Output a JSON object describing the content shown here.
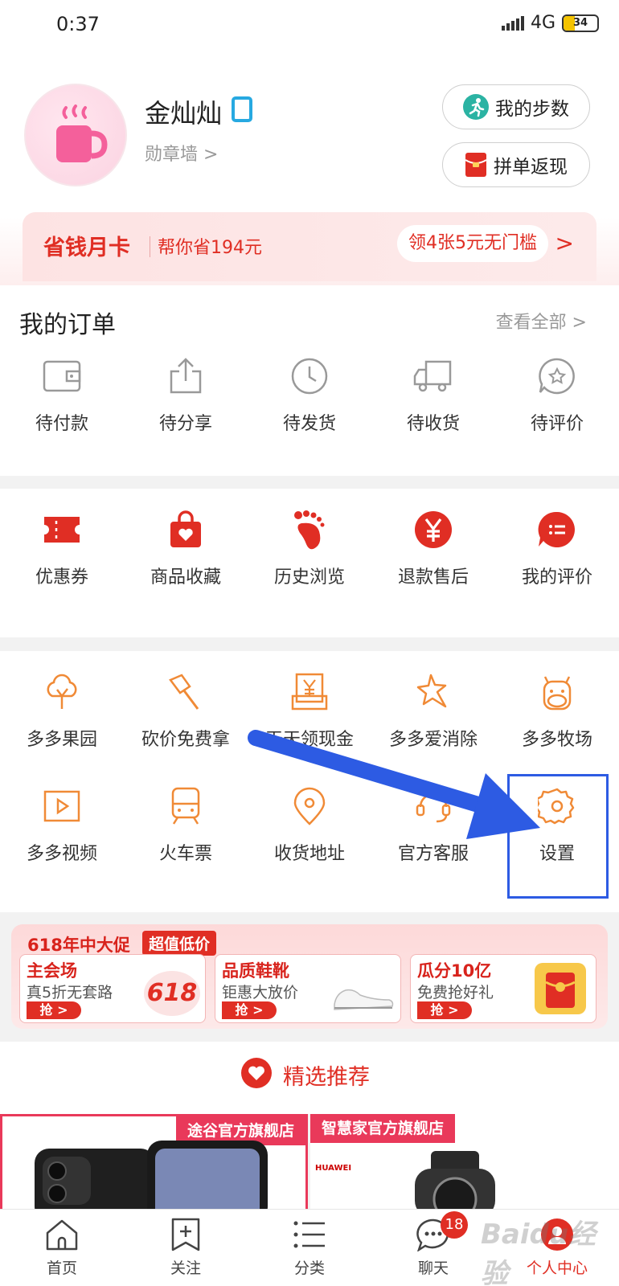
{
  "status_bar": {
    "time": "0:37",
    "network": "4G",
    "battery": "34",
    "battery_level": 0.34
  },
  "profile": {
    "name": "金灿灿",
    "medal_link": "勋章墙 >"
  },
  "header_buttons": {
    "steps": "我的步数",
    "regroup": "拼单返现"
  },
  "savings_card": {
    "title": "省钱月卡",
    "subtitle": "帮你省194元",
    "coupon": "领4张5元无门槛",
    "arrow": ">"
  },
  "orders": {
    "title": "我的订单",
    "view_all": "查看全部 >",
    "items": [
      {
        "label": "待付款",
        "icon": "wallet-icon"
      },
      {
        "label": "待分享",
        "icon": "share-icon"
      },
      {
        "label": "待发货",
        "icon": "clock-icon"
      },
      {
        "label": "待收货",
        "icon": "truck-icon"
      },
      {
        "label": "待评价",
        "icon": "review-icon"
      }
    ]
  },
  "services": [
    {
      "label": "优惠券",
      "icon": "coupon-icon"
    },
    {
      "label": "商品收藏",
      "icon": "bag-heart-icon"
    },
    {
      "label": "历史浏览",
      "icon": "footprint-icon"
    },
    {
      "label": "退款售后",
      "icon": "yen-icon"
    },
    {
      "label": "我的评价",
      "icon": "comment-icon"
    }
  ],
  "tools": [
    {
      "label": "多多果园",
      "icon": "tree-icon"
    },
    {
      "label": "砍价免费拿",
      "icon": "axe-icon"
    },
    {
      "label": "天天领现金",
      "icon": "yen-card-icon"
    },
    {
      "label": "多多爱消除",
      "icon": "star-icon"
    },
    {
      "label": "多多牧场",
      "icon": "cow-icon"
    },
    {
      "label": "多多视频",
      "icon": "video-icon"
    },
    {
      "label": "火车票",
      "icon": "train-icon"
    },
    {
      "label": "收货地址",
      "icon": "location-icon"
    },
    {
      "label": "官方客服",
      "icon": "headset-icon"
    },
    {
      "label": "设置",
      "icon": "gear-icon"
    }
  ],
  "promo": {
    "title": "618年中大促",
    "tag": "超值低价",
    "deals": [
      {
        "title": "主会场",
        "subtitle": "真5折无套路",
        "button": "抢 >",
        "badge": "618"
      },
      {
        "title": "品质鞋靴",
        "subtitle": "钜惠大放价",
        "button": "抢 >"
      },
      {
        "title": "瓜分10亿",
        "subtitle": "免费抢好礼",
        "button": "抢 >"
      }
    ]
  },
  "recommend": {
    "title": "精选推荐"
  },
  "stores": [
    {
      "name": "途谷官方旗舰店"
    },
    {
      "name": "智慧家官方旗舰店",
      "brand": "HUAWEI"
    }
  ],
  "nav": [
    {
      "label": "首页",
      "icon": "home-icon"
    },
    {
      "label": "关注",
      "icon": "follow-icon"
    },
    {
      "label": "分类",
      "icon": "category-icon"
    },
    {
      "label": "聊天",
      "icon": "chat-icon",
      "badge": "18"
    },
    {
      "label": "个人中心",
      "icon": "profile-icon",
      "active": true
    }
  ],
  "watermark": "Baidu经验",
  "colors": {
    "brand_red": "#e02e24",
    "tool_orange": "#f08a36",
    "annotation_blue": "#2d5be3"
  }
}
